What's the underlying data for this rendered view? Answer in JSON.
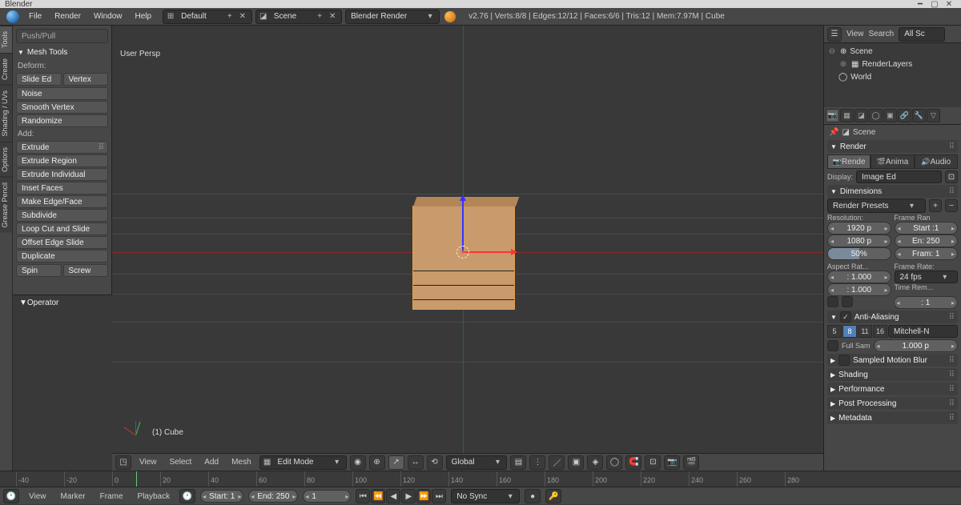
{
  "titlebar": {
    "app": "Blender"
  },
  "menubar": {
    "items": [
      "File",
      "Render",
      "Window",
      "Help"
    ],
    "layout_label": "Default",
    "scene_label": "Scene",
    "renderer_label": "Blender Render",
    "stats": "v2.76 | Verts:8/8 | Edges:12/12 | Faces:6/6 | Tris:12 | Mem:7.97M | Cube"
  },
  "vtabs": [
    "Tools",
    "Create",
    "Shading / UVs",
    "Options",
    "Grease Pencil"
  ],
  "toolpanel": {
    "top_ghost": "Push/Pull",
    "section": "Mesh Tools",
    "deform_label": "Deform:",
    "deform": {
      "slide": "Slide Ed",
      "vertex": "Vertex",
      "noise": "Noise",
      "smooth": "Smooth Vertex",
      "random": "Randomize"
    },
    "add_label": "Add:",
    "add": {
      "extrude": "Extrude",
      "extrude_region": "Extrude Region",
      "extrude_ind": "Extrude Individual",
      "inset": "Inset Faces",
      "make_edge": "Make Edge/Face",
      "subdivide": "Subdivide",
      "loopcut": "Loop Cut and Slide",
      "offset": "Offset Edge Slide",
      "duplicate": "Duplicate",
      "spin": "Spin",
      "screw": "Screw"
    }
  },
  "operator": {
    "title": "Operator"
  },
  "viewport": {
    "corner": "User Persp",
    "object": "(1) Cube",
    "header": {
      "items": [
        "View",
        "Select",
        "Add",
        "Mesh"
      ],
      "mode": "Edit Mode",
      "orientation": "Global"
    }
  },
  "outliner": {
    "header": {
      "view": "View",
      "search": "Search",
      "all": "All Sc"
    },
    "rows": [
      {
        "icon": "⊕",
        "label": "Scene"
      },
      {
        "icon": "▦",
        "label": "RenderLayers",
        "indent": 1
      },
      {
        "icon": "◯",
        "label": "World",
        "indent": 1
      }
    ]
  },
  "props": {
    "context": "Scene",
    "render": {
      "title": "Render",
      "tabs": [
        "Rende",
        "Anima",
        "Audio"
      ],
      "display_label": "Display:",
      "display_value": "Image Ed"
    },
    "dimensions": {
      "title": "Dimensions",
      "presets": "Render Presets",
      "res_label": "Resolution:",
      "frame_label": "Frame Ran",
      "res_x": "1920 p",
      "res_y": "1080 p",
      "res_pct": "50%",
      "start": "Start :1",
      "end": "En: 250",
      "step": "Fram: 1",
      "aspect_label": "Aspect Rat...",
      "rate_label": "Frame Rate:",
      "aspect_x": ": 1.000",
      "aspect_y": ": 1.000",
      "fps": "24 fps",
      "time_rem": "Time Rem...",
      "time_val": ": 1"
    },
    "aa": {
      "title": "Anti-Aliasing",
      "samples": [
        "5",
        "8",
        "11",
        "16"
      ],
      "filter": "Mitchell-N",
      "full": "Full Sam",
      "size": "1.000 p"
    },
    "collapsed": [
      "Sampled Motion Blur",
      "Shading",
      "Performance",
      "Post Processing",
      "Metadata"
    ]
  },
  "timeline": {
    "ticks": [
      "-40",
      "-20",
      "0",
      "20",
      "40",
      "60",
      "80",
      "100",
      "120",
      "140",
      "160",
      "180",
      "200",
      "220",
      "240",
      "260",
      "280"
    ],
    "header": {
      "items": [
        "View",
        "Marker",
        "Frame",
        "Playback"
      ],
      "start": "Start:       1",
      "end": "End:     250",
      "current": "1",
      "sync": "No Sync"
    }
  }
}
